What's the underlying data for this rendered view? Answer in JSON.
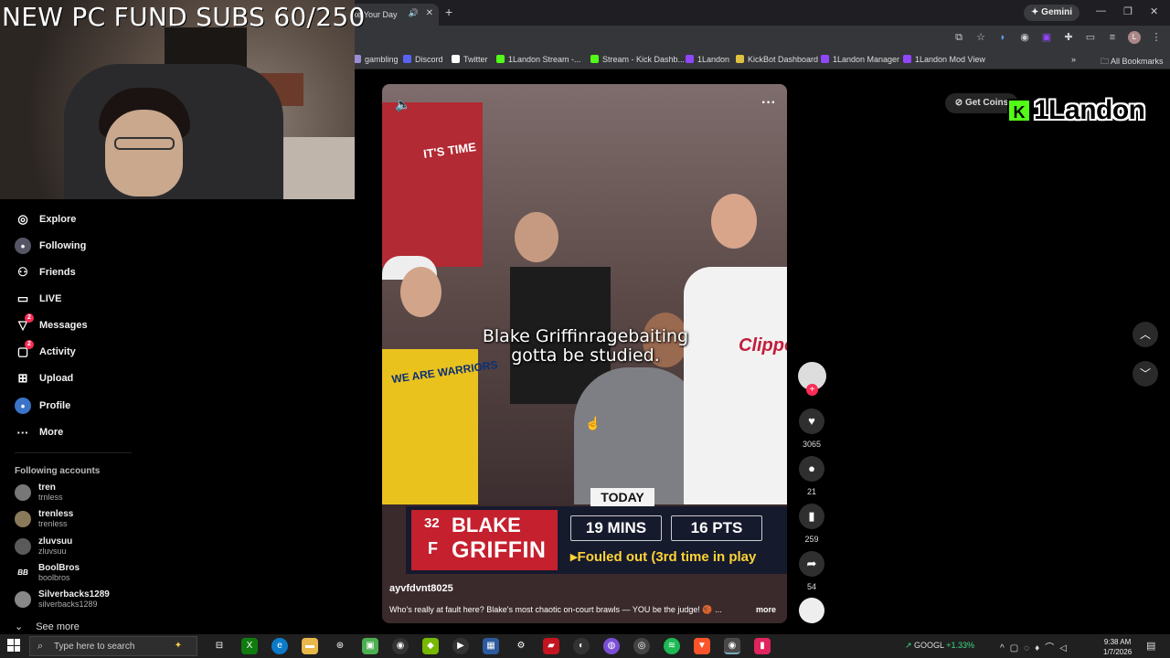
{
  "overlay": {
    "sub_goal": "NEW PC FUND SUBS 60/250"
  },
  "browser": {
    "tab_title": "ke Your Day",
    "new_tab": "+",
    "gemini_label": "Gemini",
    "bookmarks": [
      {
        "label": "gambling",
        "color": "#9a8cd8"
      },
      {
        "label": "Discord",
        "color": "#5865f2"
      },
      {
        "label": "Twitter",
        "color": "#ffffff"
      },
      {
        "label": "1Landon Stream -...",
        "color": "#53fc18"
      },
      {
        "label": "Stream - Kick Dashb...",
        "color": "#53fc18"
      },
      {
        "label": "1Landon",
        "color": "#9146ff"
      },
      {
        "label": "KickBot Dashboard",
        "color": "#e0c040"
      },
      {
        "label": "1Landon Manager",
        "color": "#9146ff"
      },
      {
        "label": "1Landon Mod View",
        "color": "#9146ff"
      }
    ],
    "all_bookmarks": "All Bookmarks"
  },
  "sidebar": {
    "items": [
      {
        "label": "Explore",
        "icon": "compass-icon"
      },
      {
        "label": "Following",
        "icon": "following-avatar-icon"
      },
      {
        "label": "Friends",
        "icon": "friends-icon"
      },
      {
        "label": "LIVE",
        "icon": "live-icon"
      },
      {
        "label": "Messages",
        "icon": "messages-icon",
        "badge": "2"
      },
      {
        "label": "Activity",
        "icon": "activity-icon",
        "badge": "2"
      },
      {
        "label": "Upload",
        "icon": "upload-icon"
      },
      {
        "label": "Profile",
        "icon": "profile-icon"
      },
      {
        "label": "More",
        "icon": "more-icon"
      }
    ],
    "following_heading": "Following accounts",
    "accounts": [
      {
        "name": "tren",
        "handle": "trnless"
      },
      {
        "name": "trenless",
        "handle": "trenless"
      },
      {
        "name": "zluvsuu",
        "handle": "zluvsuu"
      },
      {
        "name": "BoolBros",
        "handle": "boolbros",
        "avatar_text": "BB"
      },
      {
        "name": "Silverbacks1289",
        "handle": "silverbacks1289"
      }
    ],
    "see_more": "See more"
  },
  "video": {
    "caption_line1": "Blake Griffinragebaiting",
    "caption_line2": "gotta be studied.",
    "shirt1_text": "IT'S TIME",
    "shirt2_text": "WE ARE WARRIORS",
    "jersey_text": "Clippers",
    "scoreboard": {
      "today": "TODAY",
      "number": "32",
      "position": "F",
      "first_name": "BLAKE",
      "last_name": "GRIFFIN",
      "mins": "19 MINS",
      "pts": "16 PTS",
      "note": "▸Fouled out (3rd time in play"
    },
    "author": "ayvfdvnt8025",
    "description": "Who's really at fault here? Blake's most chaotic on-court brawls — YOU be the judge! 🏀 ...",
    "more": "more"
  },
  "actions": {
    "likes": "3065",
    "comments": "21",
    "saves": "259",
    "shares": "54"
  },
  "top_right": {
    "get_coins": "Get Coins",
    "brand_k": "K",
    "brand_name": "1Landon"
  },
  "taskbar": {
    "search_placeholder": "Type here to search",
    "stock_symbol": "GOOGL",
    "stock_change": "+1.33%",
    "time": "9:38 AM",
    "date": "1/7/2026"
  }
}
